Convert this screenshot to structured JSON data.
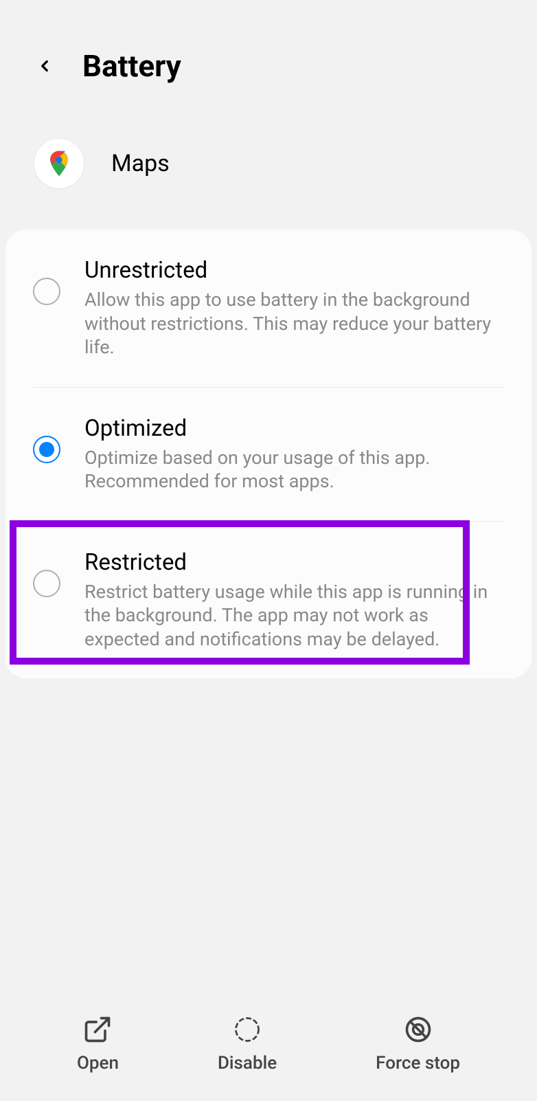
{
  "header": {
    "title": "Battery"
  },
  "app": {
    "name": "Maps"
  },
  "options": [
    {
      "title": "Unrestricted",
      "desc": "Allow this app to use battery in the background without restrictions. This may reduce your battery life.",
      "selected": false
    },
    {
      "title": "Optimized",
      "desc": "Optimize based on your usage of this app. Recommended for most apps.",
      "selected": true
    },
    {
      "title": "Restricted",
      "desc": "Restrict battery usage while this app is running in the background. The app may not work as expected and notifications may be delayed.",
      "selected": false
    }
  ],
  "bottom": {
    "open": "Open",
    "disable": "Disable",
    "force_stop": "Force stop"
  }
}
